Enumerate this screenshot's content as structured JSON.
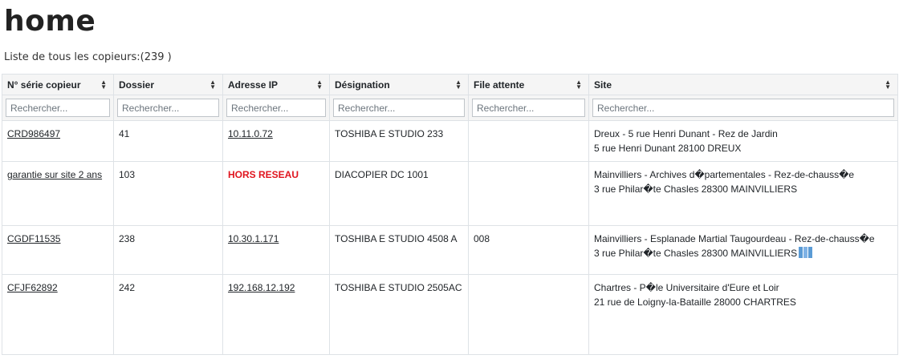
{
  "page": {
    "title": "home",
    "subtitle": "Liste de tous les copieurs:(239 )"
  },
  "table": {
    "columns": [
      "N° série copieur",
      "Dossier",
      "Adresse IP",
      "Désignation",
      "File attente",
      "Site"
    ],
    "filter_placeholder": "Rechercher...",
    "rows": [
      {
        "serie": "CRD986497",
        "dossier": "41",
        "ip": "10.11.0.72",
        "designation": "TOSHIBA E STUDIO 233",
        "file": "",
        "site_line1": "Dreux - 5 rue Henri Dunant - Rez de Jardin",
        "site_line2": "5 rue Henri Dunant 28100 DREUX"
      },
      {
        "serie": "garantie sur site 2 ans",
        "dossier": "103",
        "ip": "HORS RESEAU",
        "designation": "DIACOPIER DC 1001",
        "file": "",
        "site_line1": "Mainvilliers - Archives d�partementales - Rez-de-chauss�e",
        "site_line2": "3 rue Philar�te Chasles 28300 MAINVILLIERS"
      },
      {
        "serie": "CGDF11535",
        "dossier": "238",
        "ip": "10.30.1.171",
        "designation": "TOSHIBA E STUDIO 4508 A",
        "file": "008",
        "site_line1": "Mainvilliers - Esplanade Martial Taugourdeau - Rez-de-chauss�e",
        "site_line2": "3 rue Philar�te Chasles 28300 MAINVILLIERS"
      },
      {
        "serie": "CFJF62892",
        "dossier": "242",
        "ip": "192.168.12.192",
        "designation": "TOSHIBA E STUDIO 2505AC",
        "file": "",
        "site_line1": "Chartres - P�le Universitaire d'Eure et Loir",
        "site_line2": "21 rue de Loigny-la-Bataille 28000 CHARTRES"
      }
    ]
  },
  "colors": {
    "hors_reseau": "#e0141e",
    "header_bg": "#f5f5f5",
    "map_icon": "#5b9bd5"
  },
  "icons": {
    "sort": "sort-icon",
    "map": "map-icon"
  }
}
